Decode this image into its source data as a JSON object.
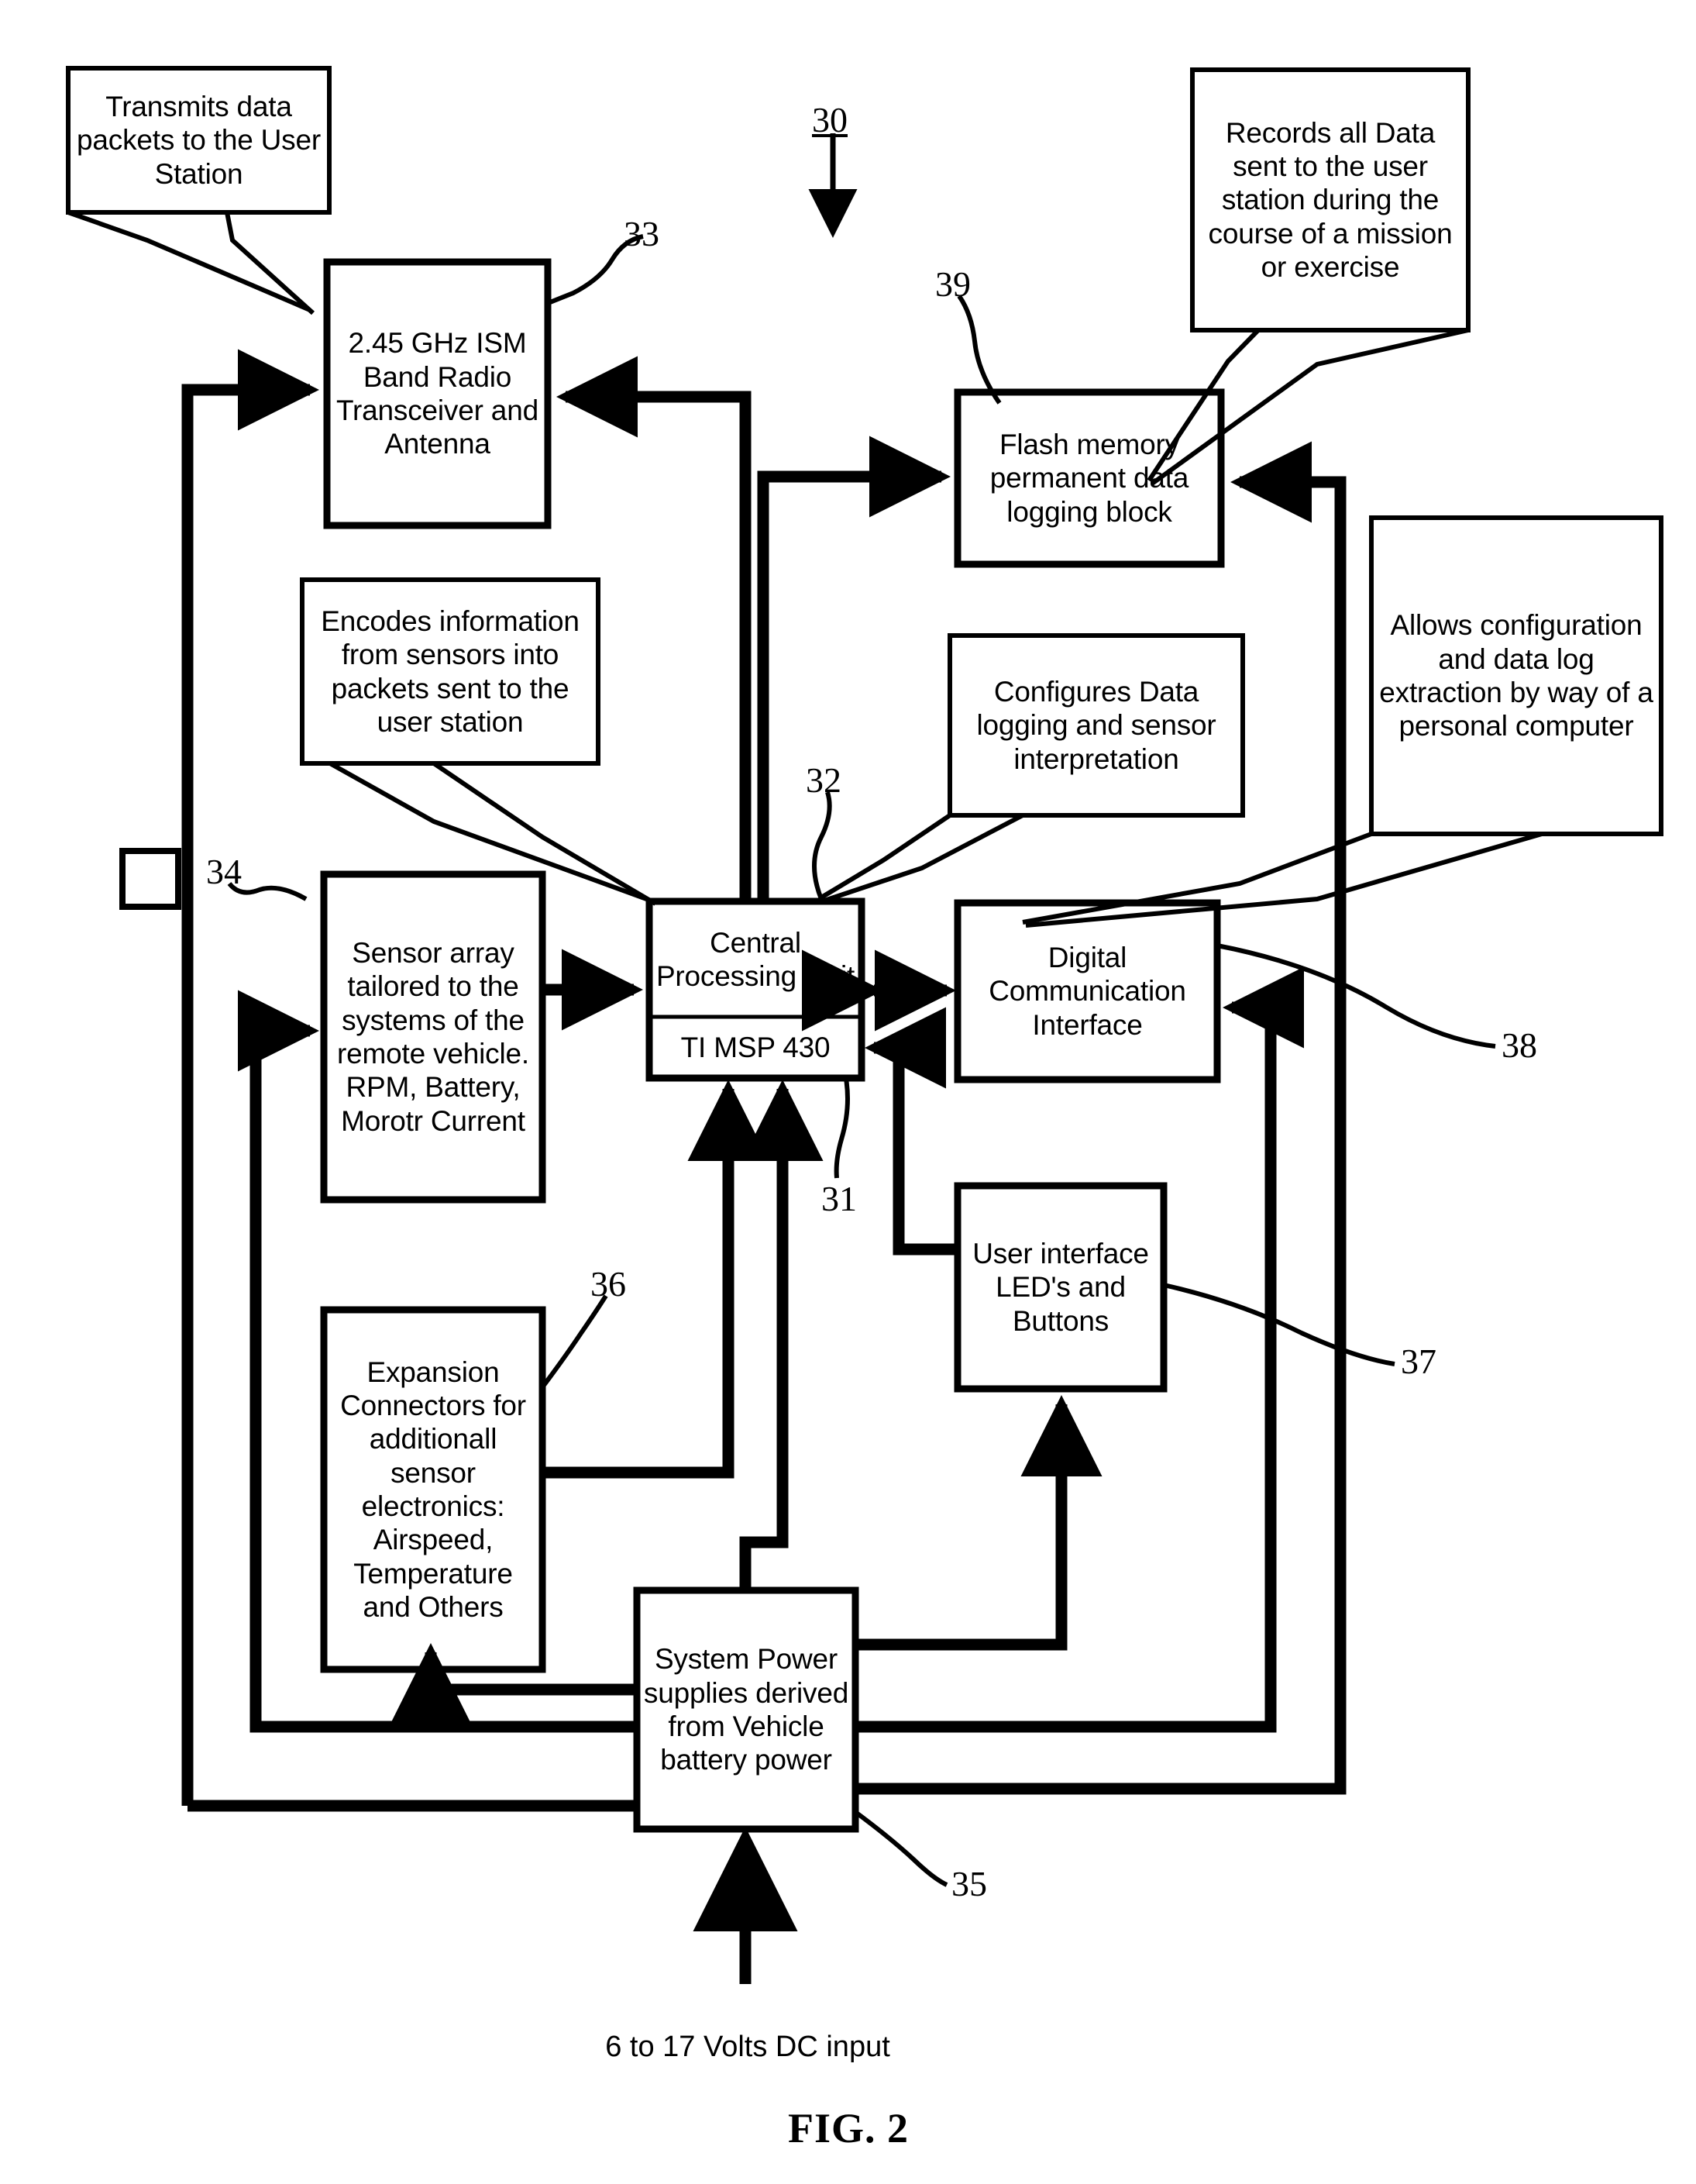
{
  "figure": {
    "caption": "FIG. 2",
    "system_ref": "30",
    "dc_input_label": "6 to 17 Volts DC input"
  },
  "blocks": [
    {
      "id": "radio-transceiver",
      "ref": "33",
      "text": "2.45 GHz ISM Band Radio Transceiver and Antenna"
    },
    {
      "id": "flash-memory",
      "ref": "39",
      "text": "Flash memory permanent data logging block"
    },
    {
      "id": "sensor-array",
      "ref": "34",
      "text": "Sensor array tailored to the systems of the remote vehicle. RPM, Battery, Morotr Current"
    },
    {
      "id": "central-processing-unit",
      "ref": "32",
      "text": "Central Processing Unit",
      "subtext": "TI MSP 430",
      "subref": "31"
    },
    {
      "id": "digital-communication-interface",
      "ref": "38",
      "text": "Digital Communication Interface"
    },
    {
      "id": "user-interface-leds",
      "ref": "37",
      "text": "User interface LED's and Buttons"
    },
    {
      "id": "expansion-connectors",
      "ref": "36",
      "text": "Expansion Connectors for additionall sensor electronics: Airspeed, Temperature and Others"
    },
    {
      "id": "system-power",
      "ref": "35",
      "text": "System Power supplies derived from Vehicle battery power"
    }
  ],
  "callouts": [
    {
      "id": "callout-transmits",
      "text": "Transmits data packets to the User Station"
    },
    {
      "id": "callout-records",
      "text": "Records all Data sent to the user station during the course of a mission or exercise"
    },
    {
      "id": "callout-encodes",
      "text": "Encodes information from sensors into packets sent to the user station"
    },
    {
      "id": "callout-configures",
      "text": "Configures Data logging and sensor interpretation"
    },
    {
      "id": "callout-allows",
      "text": "Allows configuration and data log extraction by way of a personal computer"
    }
  ],
  "colors": {
    "ink": "#000000",
    "paper": "#ffffff"
  }
}
